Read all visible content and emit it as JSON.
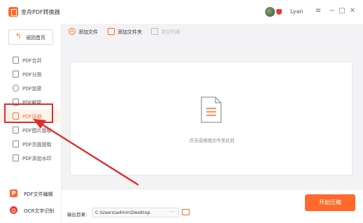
{
  "app": {
    "title": "金舟PDF转换器"
  },
  "user": {
    "name": "Lyan"
  },
  "window_controls": {
    "menu": "≡",
    "minimize": "−",
    "maximize": "□",
    "close": "✕"
  },
  "sidebar": {
    "home_label": "返回首页",
    "items": [
      {
        "label": "PDF合并",
        "icon": "merge-icon"
      },
      {
        "label": "PDF分割",
        "icon": "split-icon"
      },
      {
        "label": "PDF加密",
        "icon": "lock-icon"
      },
      {
        "label": "PDF解密",
        "icon": "unlock-icon"
      },
      {
        "label": "PDF压缩",
        "icon": "compress-icon",
        "active": true
      },
      {
        "label": "PDF图片提取",
        "icon": "image-extract-icon"
      },
      {
        "label": "PDF页面提取",
        "icon": "page-extract-icon"
      },
      {
        "label": "PDF添加水印",
        "icon": "watermark-icon"
      }
    ],
    "tools": [
      {
        "label": "PDF文件编辑",
        "icon": "pdf-edit-icon"
      },
      {
        "label": "OCR文字识别",
        "icon": "ocr-icon"
      }
    ]
  },
  "toolbar": {
    "add_file": "添加文件",
    "add_folder": "添加文件夹",
    "clear_list": "清空列表"
  },
  "drop_area": {
    "hint": "点击或拖拽文件至此处"
  },
  "bottom": {
    "output_label": "输出目录:",
    "output_path": "C:\\Users\\admin\\Desktop",
    "more": "···",
    "start_button": "开始压缩"
  },
  "colors": {
    "accent": "#ff6a2c",
    "annotation": "#e32a2a"
  }
}
